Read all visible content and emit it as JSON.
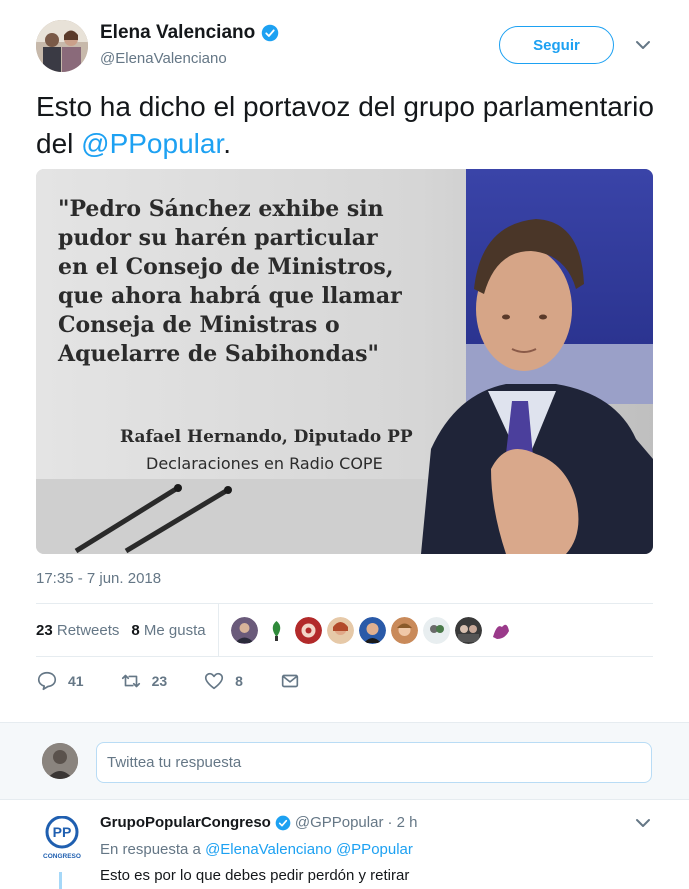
{
  "tweet": {
    "author_name": "Elena Valenciano",
    "author_handle": "@ElenaValenciano",
    "follow_label": "Seguir",
    "text_before": "Esto ha dicho el portavoz del grupo parlamentario del ",
    "text_mention": "@PPopular",
    "text_after": ".",
    "media": {
      "quote_lines": [
        "\"Pedro Sánchez exhibe sin",
        "pudor su harén particular",
        "en el Consejo de Ministros,",
        "que ahora habrá que llamar",
        "Conseja de Ministras o",
        "Aquelarre de Sabihondas\""
      ],
      "attribution_1": "Rafael Hernando, Diputado PP",
      "attribution_2": "Declaraciones en Radio COPE"
    },
    "timestamp": "17:35 - 7 jun. 2018",
    "stats": {
      "retweets_count": "23",
      "retweets_label": "Retweets",
      "likes_count": "8",
      "likes_label": "Me gusta"
    },
    "actions": {
      "reply_count": "41",
      "retweet_count": "23",
      "like_count": "8"
    }
  },
  "reply_box": {
    "placeholder": "Twittea tu respuesta"
  },
  "reply_tweet": {
    "author_name": "GrupoPopularCongreso",
    "author_handle": "@GPPopular",
    "time": "· 2 h",
    "reply_prefix": "En respuesta a",
    "reply_mention_1": "@ElenaValenciano",
    "reply_mention_2": "@PPopular",
    "text": "Esto es por lo que debes pedir perdón y retirar",
    "logo_text": "PP",
    "logo_subtext": "CONGRESO"
  },
  "colors": {
    "accent": "#1da1f2",
    "muted": "#657786",
    "text": "#14171a"
  }
}
